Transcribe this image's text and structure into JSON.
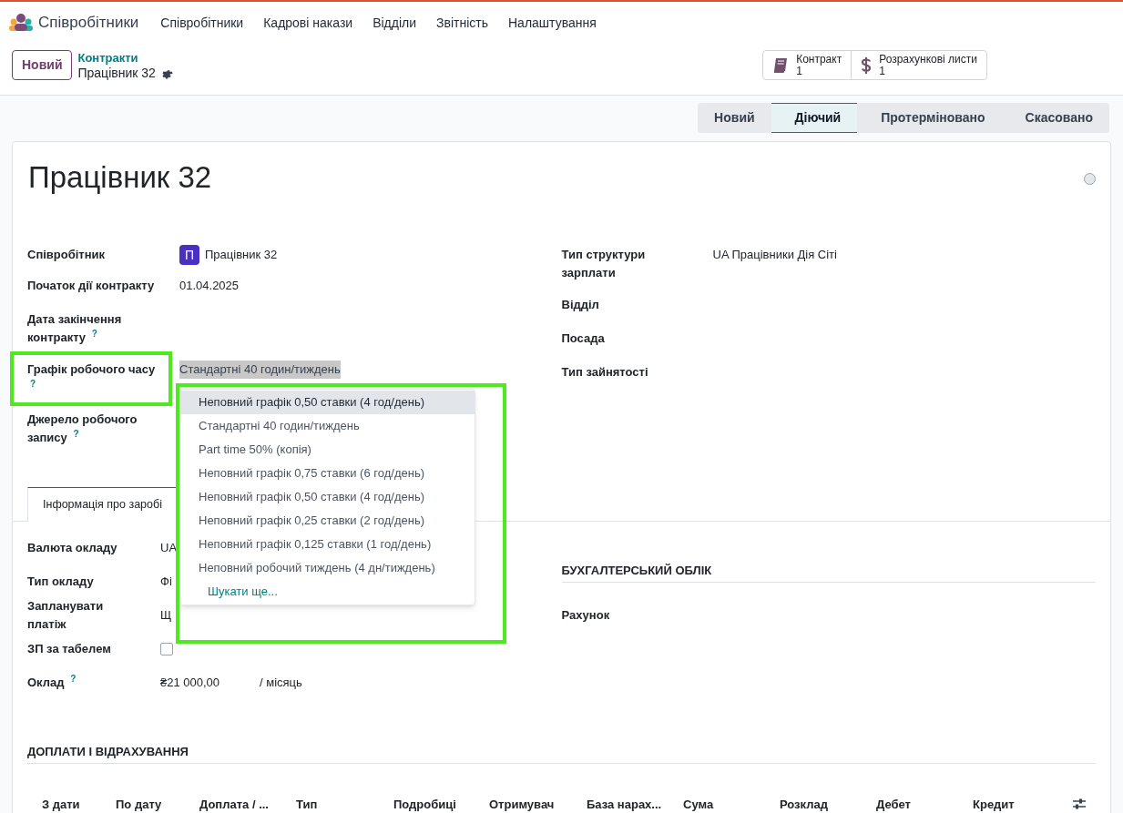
{
  "navbar": {
    "app_name": "Співробітники",
    "menu": [
      "Співробітники",
      "Кадрові накази",
      "Відділи",
      "Звітність",
      "Налаштування"
    ]
  },
  "control_panel": {
    "new_button": "Новий",
    "breadcrumb": "Контракти",
    "record": "Працівник 32",
    "smart_buttons": [
      {
        "kind": "book",
        "label": "Контракт",
        "count": "1"
      },
      {
        "kind": "dollar",
        "label": "Розрахункові листи",
        "count": "1"
      }
    ]
  },
  "statusbar": [
    {
      "label": "Новий",
      "selected": false
    },
    {
      "label": "Діючий",
      "selected": true
    },
    {
      "label": "Протерміновано",
      "selected": false
    },
    {
      "label": "Скасовано",
      "selected": false
    }
  ],
  "form": {
    "title": "Працівник 32",
    "left_fields": [
      {
        "label": "Співробітник",
        "value": "Працівник 32",
        "avatar": "П"
      },
      {
        "label": "Початок дії контракту",
        "value": "01.04.2025"
      },
      {
        "label": "Дата закінчення контракту $^{?}$"
      },
      {
        "label": "Графік робочого часу $^{?}$",
        "value": "Стандартні 40 годин/тиждень",
        "highlighted": true
      },
      {
        "label": "Джерело робочого запису $^{?}$"
      }
    ],
    "right_fields": [
      {
        "label": "Тип структури зарплати",
        "value": "UA Працівники Дія Сіті"
      },
      {
        "label": "Відділ"
      },
      {
        "label": "Посада"
      },
      {
        "label": "Тип зайнятості"
      }
    ],
    "tab": "Інформація про заробі",
    "salary_fields": [
      {
        "kind": "text",
        "label": "Валюта окладу",
        "value": "UA"
      },
      {
        "kind": "text",
        "label": "Тип окладу",
        "value": "Фі"
      },
      {
        "kind": "text",
        "label": "Запланувати платіж",
        "value": "Щ"
      },
      {
        "kind": "checkbox",
        "label": "ЗП за табелем",
        "checked": false
      },
      {
        "kind": "amount",
        "label": "Оклад $^{?}$",
        "value": "₴21 000,00",
        "unit": "/ місяць"
      }
    ],
    "accounting": {
      "heading": "БУХГАЛТЕРСЬКИЙ ОБЛІК",
      "fields": [
        "Рахунок"
      ]
    },
    "section": "ДОПЛАТИ І ВІДРАХУВАННЯ",
    "table": {
      "columns": [
        "З дати",
        "По дату",
        "Доплата / ...",
        "Тип",
        "Подробиці",
        "Отримувач",
        "База нарах...",
        "Сума",
        "Розклад",
        "Дебет",
        "Кредит"
      ]
    }
  },
  "dropdown": {
    "options": [
      {
        "label": "Неповний графік 0,50 ставки (4 год/день)",
        "selected": true
      },
      {
        "label": "Стандартні 40 годин/тиждень",
        "selected": false
      },
      {
        "label": "Part time 50% (копія)",
        "selected": false
      },
      {
        "label": "Неповний графік 0,75 ставки (6 год/день)",
        "selected": false
      },
      {
        "label": "Неповний графік 0,50 ставки (4 год/день)",
        "selected": false
      },
      {
        "label": "Неповний графік 0,25 ставки (2 год/день)",
        "selected": false
      },
      {
        "label": "Неповний графік 0,125 ставки (1 год/день)",
        "selected": false
      },
      {
        "label": "Неповний робочий тиждень (4 дн/тиждень)",
        "selected": false
      }
    ],
    "more": "Шукати ще..."
  }
}
